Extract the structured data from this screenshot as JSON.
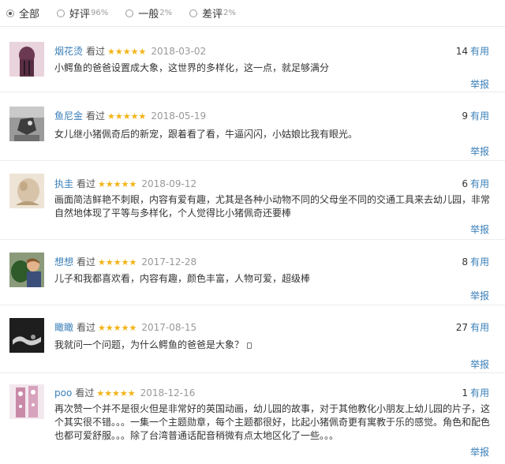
{
  "filters": [
    {
      "label": "全部",
      "pct": "",
      "selected": true
    },
    {
      "label": "好评",
      "pct": "96%",
      "selected": false
    },
    {
      "label": "一般",
      "pct": "2%",
      "selected": false
    },
    {
      "label": "差评",
      "pct": "2%",
      "selected": false
    }
  ],
  "rated_label": "看过",
  "stars": "★★★★★",
  "useful_label": "有用",
  "report_label": "举报",
  "star_color": "#f2b416",
  "link_color": "#3a7fb8",
  "reviews": [
    {
      "user": "烟花烫",
      "date": "2018-03-02",
      "useful": "14",
      "text": "小鳄鱼的爸爸设置成大象，这世界的多样化，这一点，就足够满分"
    },
    {
      "user": "鱼尼金",
      "date": "2018-05-19",
      "useful": "9",
      "text": "女儿继小猪佩奇后的新宠，跟着看了看，牛逼闪闪，小姑娘比我有眼光。"
    },
    {
      "user": "执圭",
      "date": "2018-09-12",
      "useful": "6",
      "text": "画面简洁鲜艳不刺眼，内容有爱有趣，尤其是各种小动物不同的父母坐不同的交通工具来去幼儿园，非常自然地体现了平等与多样化，个人觉得比小猪佩奇还要棒"
    },
    {
      "user": "想想",
      "date": "2017-12-28",
      "useful": "8",
      "text": "儿子和我都喜欢看，内容有趣，颜色丰富，人物可爱，超级棒"
    },
    {
      "user": "瞰瞰",
      "date": "2017-08-15",
      "useful": "27",
      "text": "我就问一个问题，为什么鳄鱼的爸爸是大象？"
    },
    {
      "user": "poo",
      "date": "2018-12-16",
      "useful": "1",
      "text": "再次赞一个并不是很火但是非常好的英国动画，幼儿园的故事，对于其他教化小朋友上幼儿园的片子，这个其实很不错。。。一集一个主题勋章，每个主题都很好，比起小猪佩奇更有寓教于乐的感觉。角色和配色也都可爱舒服。。。除了台湾普通话配音稍微有点太地区化了一些。。。"
    }
  ]
}
